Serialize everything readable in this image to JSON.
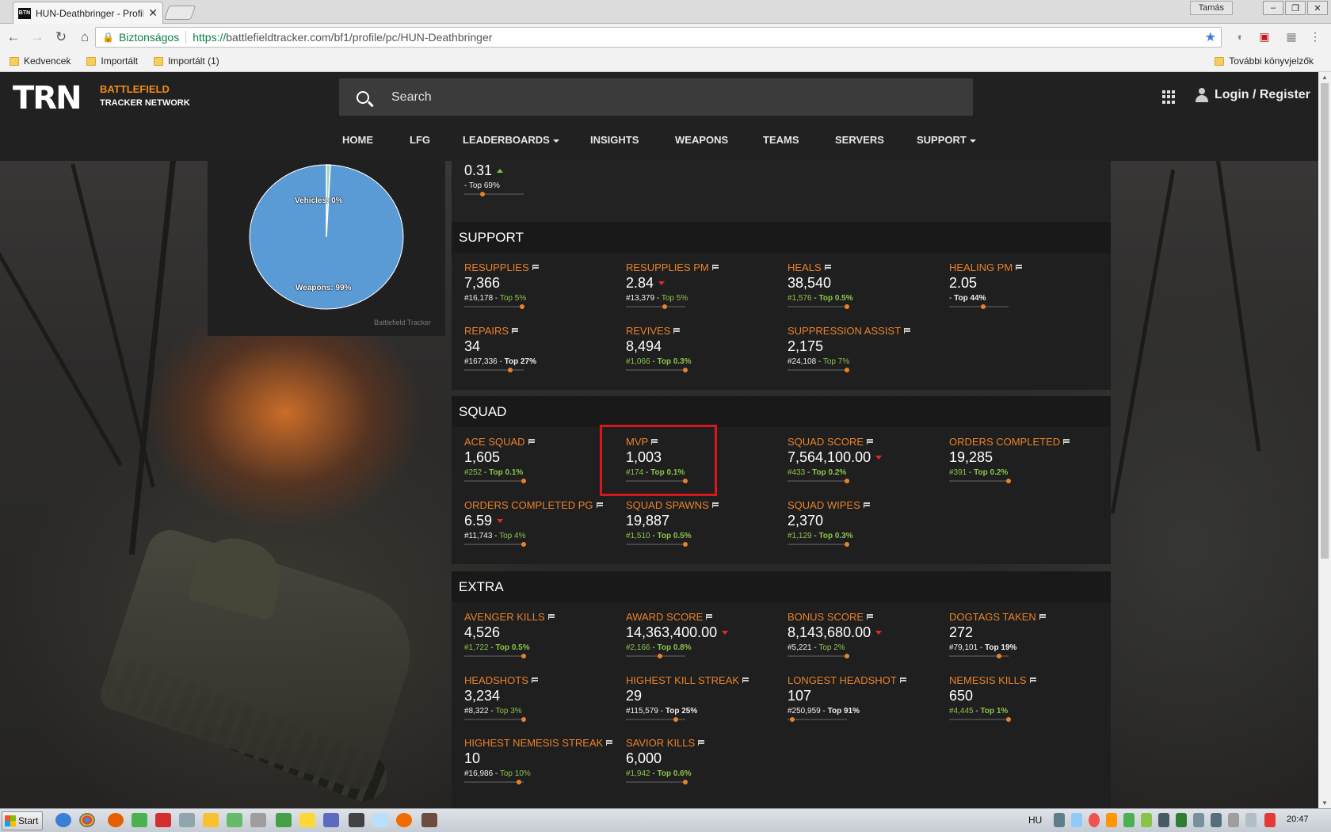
{
  "browser": {
    "tab_title": "HUN-Deathbringer - Profile",
    "favicon": "BTN",
    "window_user": "Tamás",
    "secure_label": "Biztonságos",
    "url_scheme": "https://",
    "url_rest": "battlefieldtracker.com/bf1/profile/pc/HUN-Deathbringer",
    "bookmarks": [
      "Kedvencek",
      "Importált",
      "Importált (1)"
    ],
    "bookmarks_right": "További könyvjelzők"
  },
  "site": {
    "logo": "TRN",
    "brand_line1": "BATTLEFIELD",
    "brand_line2": "TRACKER NETWORK",
    "search_placeholder": "Search",
    "login": "Login / Register",
    "nav": [
      "HOME",
      "LFG",
      "LEADERBOARDS",
      "INSIGHTS",
      "WEAPONS",
      "TEAMS",
      "SERVERS",
      "SUPPORT"
    ]
  },
  "pie": {
    "labels": [
      "Vehicles: 0%",
      "Weapons: 99%"
    ],
    "credit": "Battlefield Tracker",
    "colors": {
      "weapons": "#5b9bd5",
      "vehicles": "#a8d5b0"
    }
  },
  "top_stat": {
    "value": "0.31",
    "sub": "- Top 69%",
    "trend": "up"
  },
  "sections": {
    "support": {
      "title": "SUPPORT",
      "stats": [
        {
          "label": "RESUPPLIES",
          "value": "7,366",
          "rank": "#16,178",
          "top": "Top 5%",
          "trend": ""
        },
        {
          "label": "RESUPPLIES PM",
          "value": "2.84",
          "rank": "#13,379",
          "top": "Top 5%",
          "trend": "down"
        },
        {
          "label": "HEALS",
          "value": "38,540",
          "rank": "#1,576",
          "top": "Top 0.5%",
          "trend": ""
        },
        {
          "label": "HEALING PM",
          "value": "2.05",
          "rank": "",
          "top": "Top 44%",
          "trend": ""
        },
        {
          "label": "REPAIRS",
          "value": "34",
          "rank": "#167,336",
          "top": "Top 27%",
          "trend": ""
        },
        {
          "label": "REVIVES",
          "value": "8,494",
          "rank": "#1,066",
          "top": "Top 0.3%",
          "trend": ""
        },
        {
          "label": "SUPPRESSION ASSIST",
          "value": "2,175",
          "rank": "#24,108",
          "top": "Top 7%",
          "trend": ""
        }
      ]
    },
    "squad": {
      "title": "SQUAD",
      "stats": [
        {
          "label": "ACE SQUAD",
          "value": "1,605",
          "rank": "#252",
          "top": "Top 0.1%",
          "trend": ""
        },
        {
          "label": "MVP",
          "value": "1,003",
          "rank": "#174",
          "top": "Top 0.1%",
          "trend": ""
        },
        {
          "label": "SQUAD SCORE",
          "value": "7,564,100.00",
          "rank": "#433",
          "top": "Top 0.2%",
          "trend": "down"
        },
        {
          "label": "ORDERS COMPLETED",
          "value": "19,285",
          "rank": "#391",
          "top": "Top 0.2%",
          "trend": ""
        },
        {
          "label": "ORDERS COMPLETED PG",
          "value": "6.59",
          "rank": "#11,743",
          "top": "Top 4%",
          "trend": "down"
        },
        {
          "label": "SQUAD SPAWNS",
          "value": "19,887",
          "rank": "#1,510",
          "top": "Top 0.5%",
          "trend": ""
        },
        {
          "label": "SQUAD WIPES",
          "value": "2,370",
          "rank": "#1,129",
          "top": "Top 0.3%",
          "trend": ""
        }
      ]
    },
    "extra": {
      "title": "EXTRA",
      "stats": [
        {
          "label": "AVENGER KILLS",
          "value": "4,526",
          "rank": "#1,722",
          "top": "Top 0.5%",
          "trend": ""
        },
        {
          "label": "AWARD SCORE",
          "value": "14,363,400.00",
          "rank": "#2,166",
          "top": "Top 0.8%",
          "trend": "down"
        },
        {
          "label": "BONUS SCORE",
          "value": "8,143,680.00",
          "rank": "#5,221",
          "top": "Top 2%",
          "trend": "down"
        },
        {
          "label": "DOGTAGS TAKEN",
          "value": "272",
          "rank": "#79,101",
          "top": "Top 19%",
          "trend": ""
        },
        {
          "label": "HEADSHOTS",
          "value": "3,234",
          "rank": "#8,322",
          "top": "Top 3%",
          "trend": ""
        },
        {
          "label": "HIGHEST KILL STREAK",
          "value": "29",
          "rank": "#115,579",
          "top": "Top 25%",
          "trend": ""
        },
        {
          "label": "LONGEST HEADSHOT",
          "value": "107",
          "rank": "#250,959",
          "top": "Top 91%",
          "trend": ""
        },
        {
          "label": "NEMESIS KILLS",
          "value": "650",
          "rank": "#4,445",
          "top": "Top 1%",
          "trend": ""
        },
        {
          "label": "HIGHEST NEMESIS STREAK",
          "value": "10",
          "rank": "#16,986",
          "top": "Top 10%",
          "trend": ""
        },
        {
          "label": "SAVIOR KILLS",
          "value": "6,000",
          "rank": "#1,942",
          "top": "Top 0.6%",
          "trend": ""
        }
      ]
    }
  },
  "taskbar": {
    "start": "Start",
    "lang": "HU",
    "clock": "20:47"
  }
}
